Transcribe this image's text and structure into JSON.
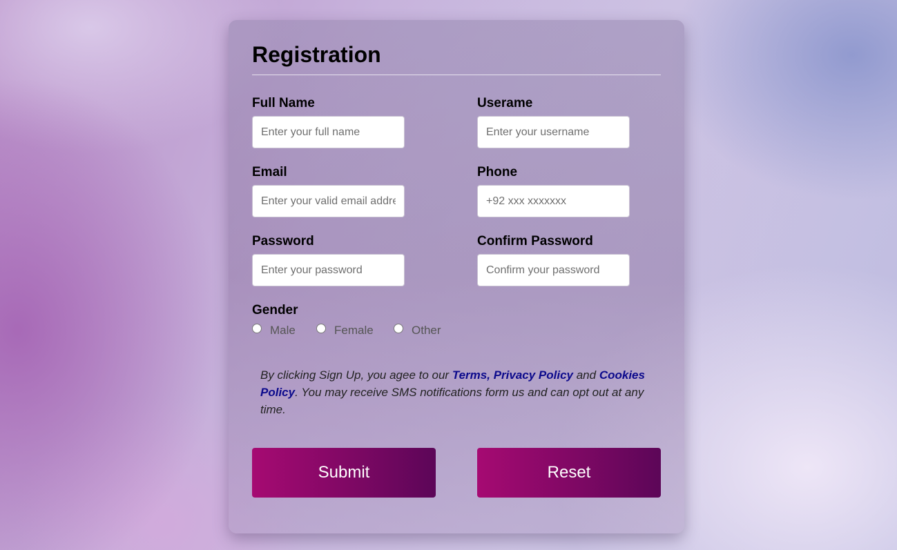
{
  "form": {
    "title": "Registration",
    "fields": {
      "full_name": {
        "label": "Full Name",
        "placeholder": "Enter your full name",
        "value": ""
      },
      "username": {
        "label": "Userame",
        "placeholder": "Enter your username",
        "value": ""
      },
      "email": {
        "label": "Email",
        "placeholder": "Enter your valid email address",
        "value": ""
      },
      "phone": {
        "label": "Phone",
        "placeholder": "+92 xxx xxxxxxx",
        "value": ""
      },
      "password": {
        "label": "Password",
        "placeholder": "Enter your password",
        "value": ""
      },
      "confirm_password": {
        "label": "Confirm Password",
        "placeholder": "Confirm your password",
        "value": ""
      }
    },
    "gender": {
      "label": "Gender",
      "options": [
        "Male",
        "Female",
        "Other"
      ],
      "selected": ""
    },
    "terms": {
      "prefix": "By clicking Sign Up, you agee to our ",
      "terms_link": "Terms,",
      "privacy_link": "Privacy Policy",
      "and": " and ",
      "cookies_link": "Cookies Policy",
      "suffix": ". You may receive SMS notifications form us and can opt out at any time."
    },
    "buttons": {
      "submit": "Submit",
      "reset": "Reset"
    },
    "colors": {
      "button_gradient_start": "#a60a72",
      "button_gradient_end": "#5c0658",
      "link": "#0c0a8c"
    }
  }
}
